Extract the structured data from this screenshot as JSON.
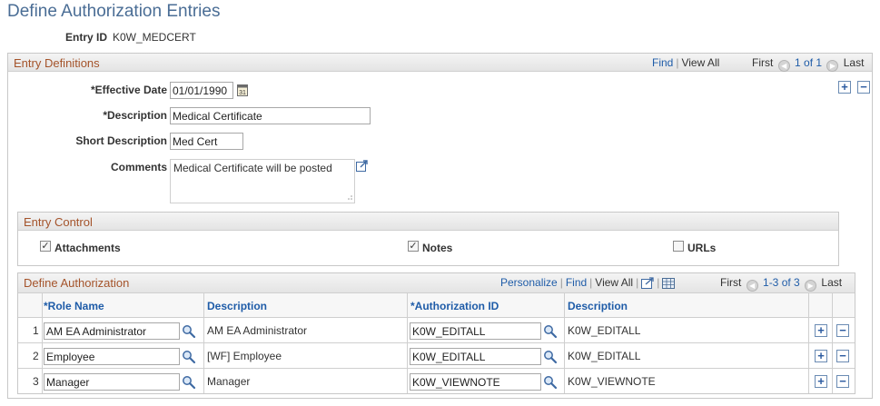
{
  "page": {
    "title": "Define Authorization Entries"
  },
  "entry": {
    "id_label": "Entry ID",
    "id_value": "K0W_MEDCERT"
  },
  "entry_definitions": {
    "title": "Entry Definitions",
    "find": "Find",
    "view_all": "View All",
    "first": "First",
    "range": "1 of 1",
    "last": "Last",
    "effective_date_label": "*Effective Date",
    "effective_date_value": "01/01/1990",
    "description_label": "*Description",
    "description_value": "Medical Certificate",
    "short_description_label": "Short Description",
    "short_description_value": "Med Cert",
    "comments_label": "Comments",
    "comments_value": "Medical Certificate will be posted"
  },
  "entry_control": {
    "title": "Entry Control",
    "items": [
      {
        "label": "Attachments",
        "checked": true
      },
      {
        "label": "Notes",
        "checked": true
      },
      {
        "label": "URLs",
        "checked": false
      }
    ]
  },
  "define_authorization": {
    "title": "Define Authorization",
    "personalize": "Personalize",
    "find": "Find",
    "view_all": "View All",
    "first": "First",
    "range": "1-3 of 3",
    "last": "Last",
    "columns": [
      "*Role Name",
      "Description",
      "*Authorization ID",
      "Description"
    ],
    "rows": [
      {
        "num": "1",
        "role": "AM EA Administrator",
        "role_desc": "AM EA Administrator",
        "auth_id": "K0W_EDITALL",
        "auth_desc": "K0W_EDITALL"
      },
      {
        "num": "2",
        "role": "Employee",
        "role_desc": "[WF] Employee",
        "auth_id": "K0W_EDITALL",
        "auth_desc": "K0W_EDITALL"
      },
      {
        "num": "3",
        "role": "Manager",
        "role_desc": "Manager",
        "auth_id": "K0W_VIEWNOTE",
        "auth_desc": "K0W_VIEWNOTE"
      }
    ]
  },
  "icons": {
    "calendar": "calendar-icon",
    "lookup": "magnifier-icon",
    "expand": "expand-icon",
    "zoom": "zoom-icon",
    "grid": "grid-download-icon",
    "prev": "prev-arrow-icon",
    "next": "next-arrow-icon",
    "add": "plus-icon",
    "remove": "minus-icon"
  },
  "colors": {
    "title": "#4a6d95",
    "section_title": "#a4532a",
    "link": "#1f5ca8"
  }
}
